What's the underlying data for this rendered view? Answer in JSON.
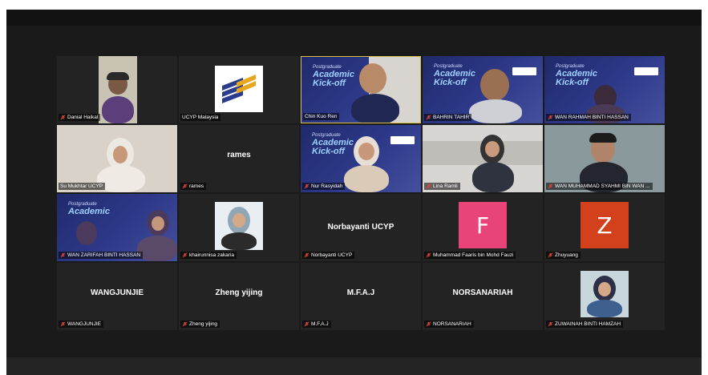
{
  "meeting": {
    "participants": [
      {
        "id": "p1",
        "name": "Danial Haikal",
        "muted": true,
        "type": "video"
      },
      {
        "id": "p2",
        "name": "UCYP Malaysia",
        "muted": false,
        "type": "logo"
      },
      {
        "id": "p3",
        "name": "Chin Kuo Ren",
        "muted": false,
        "type": "video"
      },
      {
        "id": "p4",
        "name": "BAHRIN TAHIR",
        "muted": true,
        "type": "video"
      },
      {
        "id": "p5",
        "name": "WAN RAHMAH BINTI HASSAN",
        "muted": true,
        "type": "video"
      },
      {
        "id": "p6",
        "name": "Su Mukhtar UCYP",
        "muted": false,
        "type": "video"
      },
      {
        "id": "p7",
        "name": "rames",
        "muted": true,
        "type": "name",
        "display": "rames"
      },
      {
        "id": "p8",
        "name": "Nur Rasyidah",
        "muted": true,
        "type": "video"
      },
      {
        "id": "p9",
        "name": "Lina Ramli",
        "muted": true,
        "type": "video"
      },
      {
        "id": "p10",
        "name": "WAN MUHAMMAD SYAHMI BIN WAN ...",
        "muted": true,
        "type": "video"
      },
      {
        "id": "p11",
        "name": "WAN ZARIFAH BINTI HASSAN",
        "muted": true,
        "type": "video"
      },
      {
        "id": "p12",
        "name": "khairunnisa zakaria",
        "muted": true,
        "type": "photo"
      },
      {
        "id": "p13",
        "name": "Norbayanti UCYP",
        "muted": true,
        "type": "name",
        "display": "Norbayanti UCYP"
      },
      {
        "id": "p14",
        "name": "Muhammad Faaris bin Mohd Fauzi",
        "muted": true,
        "type": "letter",
        "letter": "F",
        "color": "#e8447a"
      },
      {
        "id": "p15",
        "name": "Zhuyuang",
        "muted": true,
        "type": "letter",
        "letter": "Z",
        "color": "#d2401c"
      },
      {
        "id": "p16",
        "name": "WANGJUNJIE",
        "muted": true,
        "type": "name",
        "display": "WANGJUNJIE"
      },
      {
        "id": "p17",
        "name": "Zheng yijing",
        "muted": true,
        "type": "name",
        "display": "Zheng yijing"
      },
      {
        "id": "p18",
        "name": "M.F.A.J",
        "muted": true,
        "type": "name",
        "display": "M.F.A.J"
      },
      {
        "id": "p19",
        "name": "NORSANARIAH",
        "muted": true,
        "type": "name",
        "display": "NORSANARIAH"
      },
      {
        "id": "p20",
        "name": "ZUWAINAH BINTI HAMZAH",
        "muted": true,
        "type": "photo"
      }
    ],
    "banner": {
      "line1": "Postgraduate",
      "line2": "Academic",
      "line3": "Kick-off"
    }
  },
  "colors": {
    "mic_muted": "#e0453a",
    "tile_bg": "#232323",
    "frame_bg": "#1a1a1a"
  }
}
